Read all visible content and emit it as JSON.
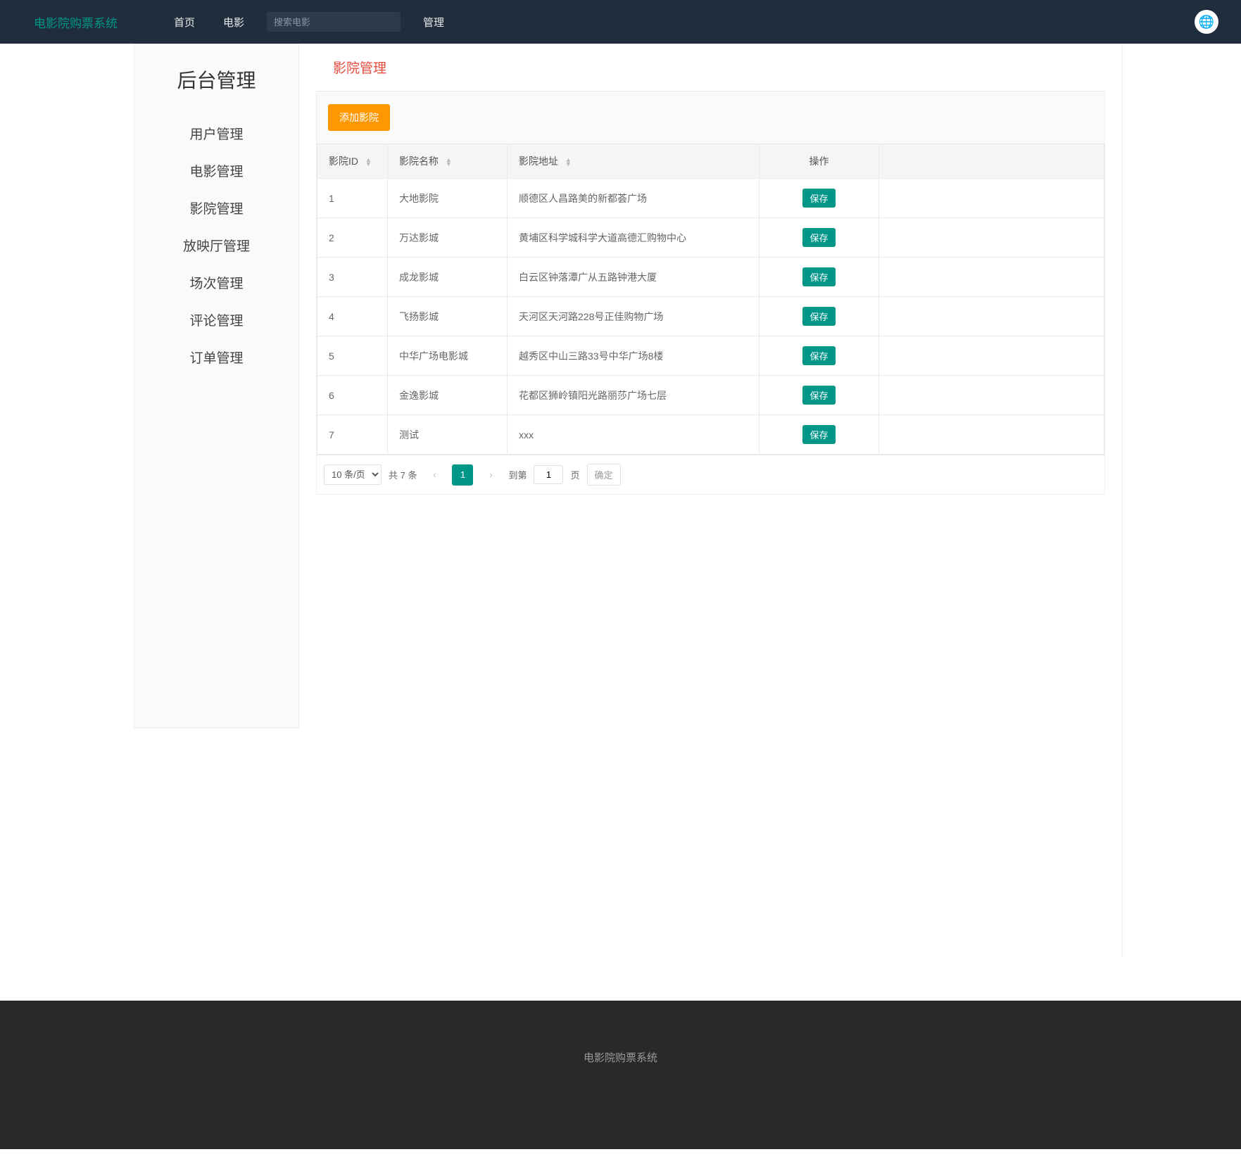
{
  "nav": {
    "brand": "电影院购票系统",
    "links": {
      "home": "首页",
      "movies": "电影",
      "admin": "管理"
    },
    "search_placeholder": "搜索电影",
    "avatar_emoji": "🌐"
  },
  "sidebar": {
    "title": "后台管理",
    "items": [
      "用户管理",
      "电影管理",
      "影院管理",
      "放映厅管理",
      "场次管理",
      "评论管理",
      "订单管理"
    ]
  },
  "page": {
    "title": "影院管理",
    "add_button": "添加影院",
    "save_label": "保存"
  },
  "table": {
    "headers": {
      "id": "影院ID",
      "name": "影院名称",
      "addr": "影院地址",
      "op": "操作"
    },
    "rows": [
      {
        "id": "1",
        "name": "大地影院",
        "addr": "顺德区人昌路美的新都荟广场"
      },
      {
        "id": "2",
        "name": "万达影城",
        "addr": "黄埔区科学城科学大道高德汇购物中心"
      },
      {
        "id": "3",
        "name": "成龙影城",
        "addr": "白云区钟落潭广从五路钟港大厦"
      },
      {
        "id": "4",
        "name": "飞扬影城",
        "addr": "天河区天河路228号正佳购物广场"
      },
      {
        "id": "5",
        "name": "中华广场电影城",
        "addr": "越秀区中山三路33号中华广场8楼"
      },
      {
        "id": "6",
        "name": "金逸影城",
        "addr": "花都区狮岭镇阳光路丽莎广场七层"
      },
      {
        "id": "7",
        "name": "测试",
        "addr": "xxx"
      }
    ]
  },
  "pager": {
    "page_size_label": "10 条/页",
    "total_text": "共 7 条",
    "current": "1",
    "jump_prefix": "到第",
    "jump_value": "1",
    "jump_suffix": "页",
    "confirm": "确定"
  },
  "footer": {
    "text": "电影院购票系统"
  }
}
